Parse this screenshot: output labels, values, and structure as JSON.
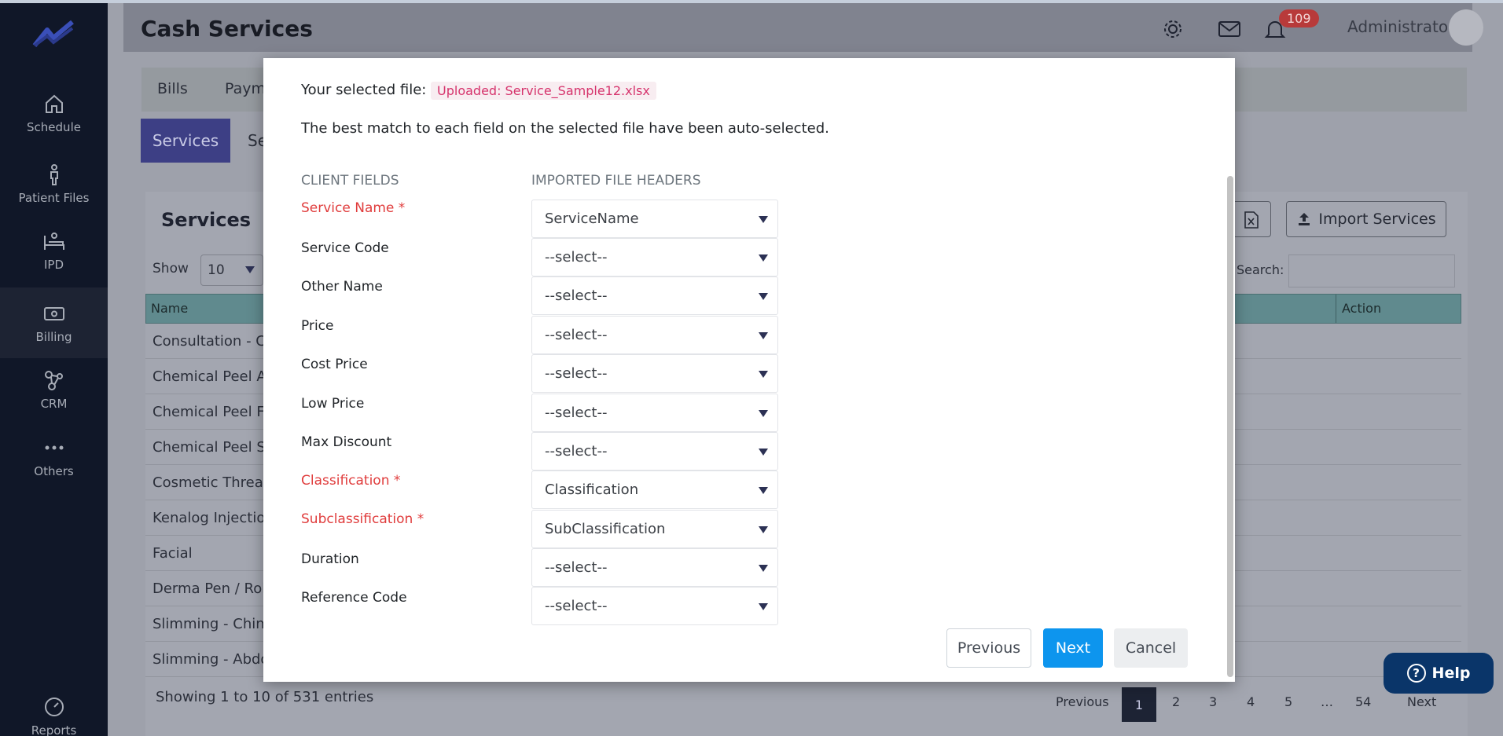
{
  "sidebar": {
    "items": [
      {
        "label": "Schedule",
        "icon": "home-icon"
      },
      {
        "label": "Patient Files",
        "icon": "person-icon"
      },
      {
        "label": "IPD",
        "icon": "bed-icon"
      },
      {
        "label": "Billing",
        "icon": "money-icon"
      },
      {
        "label": "CRM",
        "icon": "network-icon"
      },
      {
        "label": "Others",
        "icon": "more-icon"
      },
      {
        "label": "Reports",
        "icon": "gauge-icon"
      }
    ]
  },
  "header": {
    "title": "Cash Services",
    "notification_count": "109",
    "user_name": "Administrator"
  },
  "subnav": {
    "items": [
      "Bills",
      "Payme"
    ]
  },
  "tabs": {
    "active": "Services",
    "second": "Se"
  },
  "card": {
    "title": "Services",
    "show_label": "Show",
    "show_value": "10",
    "search_label": "Search:",
    "import_button": "Import Services"
  },
  "table": {
    "columns": [
      "Name",
      "Action"
    ],
    "rows": [
      "Consultation - Co",
      "Chemical Peel A",
      "Chemical Peel Fa",
      "Chemical Peel Sl",
      "Cosmetic Thread",
      "Kenalog Injection",
      "Facial",
      "Derma Pen / Rol",
      "Slimming - Chin",
      "Slimming - Abdo"
    ],
    "entries_info": "Showing 1 to 10 of 531 entries"
  },
  "pagination": {
    "previous": "Previous",
    "pages": [
      "1",
      "2",
      "3",
      "4",
      "5",
      "…",
      "54"
    ],
    "next": "Next",
    "active": "1"
  },
  "help": {
    "label": "Help"
  },
  "modal": {
    "selected_file_label": "Your selected file: :",
    "selected_file_value": "Uploaded: Service_Sample12.xlsx",
    "automatch_note": "The best match to each field on the selected file have been auto-selected.",
    "client_fields_header": "CLIENT FIELDS",
    "file_headers_header": "IMPORTED FILE HEADERS",
    "fields": [
      {
        "label": "Service Name *",
        "required": true,
        "value": "ServiceName"
      },
      {
        "label": "Service Code",
        "required": false,
        "value": "--select--"
      },
      {
        "label": "Other Name",
        "required": false,
        "value": "--select--"
      },
      {
        "label": "Price",
        "required": false,
        "value": "--select--"
      },
      {
        "label": "Cost Price",
        "required": false,
        "value": "--select--"
      },
      {
        "label": "Low Price",
        "required": false,
        "value": "--select--"
      },
      {
        "label": "Max Discount",
        "required": false,
        "value": "--select--"
      },
      {
        "label": "Classification *",
        "required": true,
        "value": "Classification"
      },
      {
        "label": "Subclassification *",
        "required": true,
        "value": "SubClassification"
      },
      {
        "label": "Duration",
        "required": false,
        "value": "--select--"
      },
      {
        "label": "Reference Code",
        "required": false,
        "value": "--select--"
      }
    ],
    "previous_button": "Previous",
    "next_button": "Next",
    "cancel_button": "Cancel"
  },
  "colors": {
    "sidebar_bg": "#101728",
    "primary_button": "#0d95ee",
    "required_label": "#e03c3c",
    "file_chip_text": "#d6336c",
    "help_button": "#0a3569",
    "active_tab": "#3d3f85"
  }
}
